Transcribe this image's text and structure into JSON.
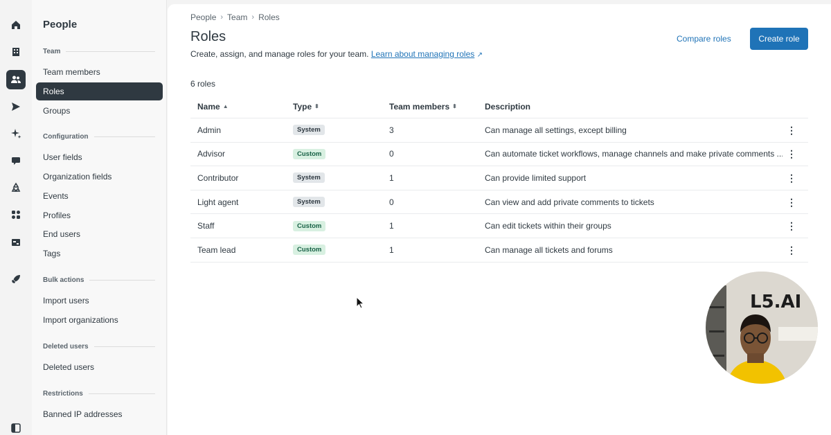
{
  "rail": {
    "icons": [
      "home-icon",
      "building-icon",
      "people-icon",
      "send-icon",
      "sparkle-icon",
      "chat-icon",
      "recycle-icon",
      "apps-icon",
      "workspace-icon",
      "rocket-icon",
      "sidebar-toggle-icon"
    ],
    "active": "people-icon"
  },
  "subnav": {
    "title": "People",
    "sections": {
      "team": "Team",
      "configuration": "Configuration",
      "bulk_actions": "Bulk actions",
      "deleted_users": "Deleted users",
      "restrictions": "Restrictions"
    },
    "items": {
      "team_members": "Team members",
      "roles": "Roles",
      "groups": "Groups",
      "user_fields": "User fields",
      "organization_fields": "Organization fields",
      "events": "Events",
      "profiles": "Profiles",
      "end_users": "End users",
      "tags": "Tags",
      "import_users": "Import users",
      "import_organizations": "Import organizations",
      "deleted_users": "Deleted users",
      "banned_ip": "Banned IP addresses"
    },
    "active_item": "Roles"
  },
  "breadcrumb": [
    "People",
    "Team",
    "Roles"
  ],
  "page": {
    "title": "Roles",
    "subtitle": "Create, assign, and manage roles for your team.",
    "learn_link": "Learn about managing roles",
    "compare_label": "Compare roles",
    "create_label": "Create role",
    "count": "6 roles"
  },
  "table": {
    "headers": {
      "name": "Name",
      "type": "Type",
      "members": "Team members",
      "description": "Description"
    },
    "rows": [
      {
        "name": "Admin",
        "type": "System",
        "members": "3",
        "description": "Can manage all settings, except billing"
      },
      {
        "name": "Advisor",
        "type": "Custom",
        "members": "0",
        "description": "Can automate ticket workflows, manage channels and make private comments ..."
      },
      {
        "name": "Contributor",
        "type": "System",
        "members": "1",
        "description": "Can provide limited support"
      },
      {
        "name": "Light agent",
        "type": "System",
        "members": "0",
        "description": "Can view and add private comments to tickets"
      },
      {
        "name": "Staff",
        "type": "Custom",
        "members": "1",
        "description": "Can edit tickets within their groups"
      },
      {
        "name": "Team lead",
        "type": "Custom",
        "members": "1",
        "description": "Can manage all tickets and forums"
      }
    ]
  },
  "webcam": {
    "sign_text": "L5.AI"
  },
  "colors": {
    "accent": "#1f73b7",
    "nav_active": "#2f3941",
    "badge_system": "#e2e6e9",
    "badge_custom": "#d8f0e1"
  }
}
